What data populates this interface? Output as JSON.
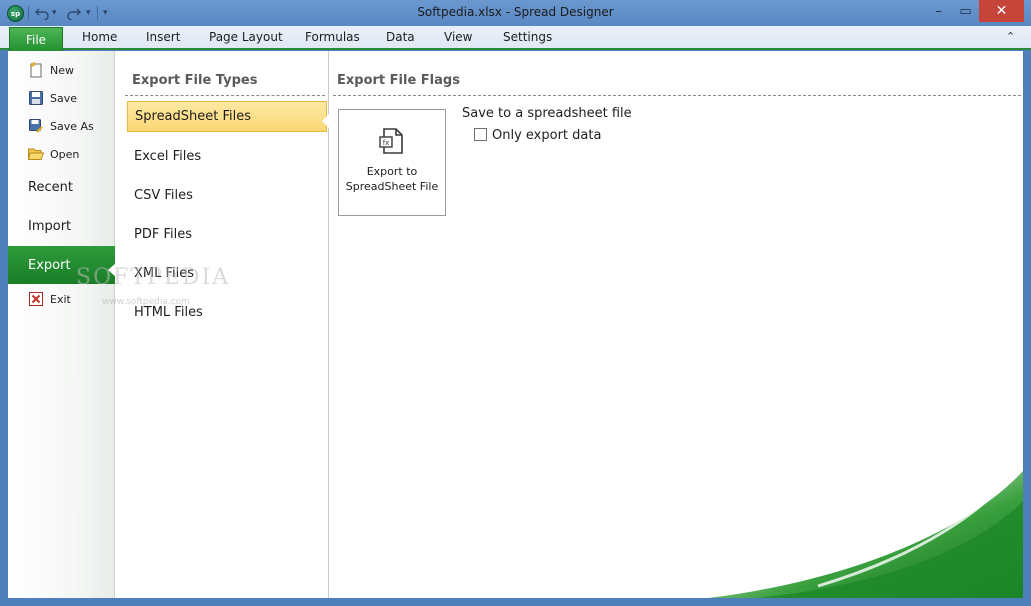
{
  "window": {
    "title": "Softpedia.xlsx - Spread Designer",
    "app_icon_text": "sp",
    "undo_icon": "undo-icon",
    "redo_icon": "redo-icon",
    "minimize": "–",
    "maximize": "▭",
    "close": "✕"
  },
  "ribbon": {
    "file_tab": "File",
    "tabs": [
      "Home",
      "Insert",
      "Page Layout",
      "Formulas",
      "Data",
      "View",
      "Settings"
    ],
    "collapse": "⌃"
  },
  "nav": {
    "new": "New",
    "save": "Save",
    "save_as": "Save As",
    "open": "Open",
    "recent": "Recent",
    "import": "Import",
    "export": "Export",
    "exit": "Exit"
  },
  "export_types": {
    "heading": "Export File Types",
    "items": [
      "SpreadSheet Files",
      "Excel Files",
      "CSV Files",
      "PDF Files",
      "XML Files",
      "HTML Files"
    ],
    "selected": "SpreadSheet Files"
  },
  "export_flags": {
    "heading": "Export File Flags",
    "button_label": "Export to\nSpreadSheet File",
    "description": "Save to a spreadsheet file",
    "checkbox_label": "Only export data",
    "checkbox_checked": false
  },
  "watermark": {
    "text": "SOFTPEDIA",
    "url": "www.softpedia.com"
  },
  "colors": {
    "accent_green": "#1b7d28",
    "selection": "#fbd774",
    "titlebar": "#5887c2"
  }
}
